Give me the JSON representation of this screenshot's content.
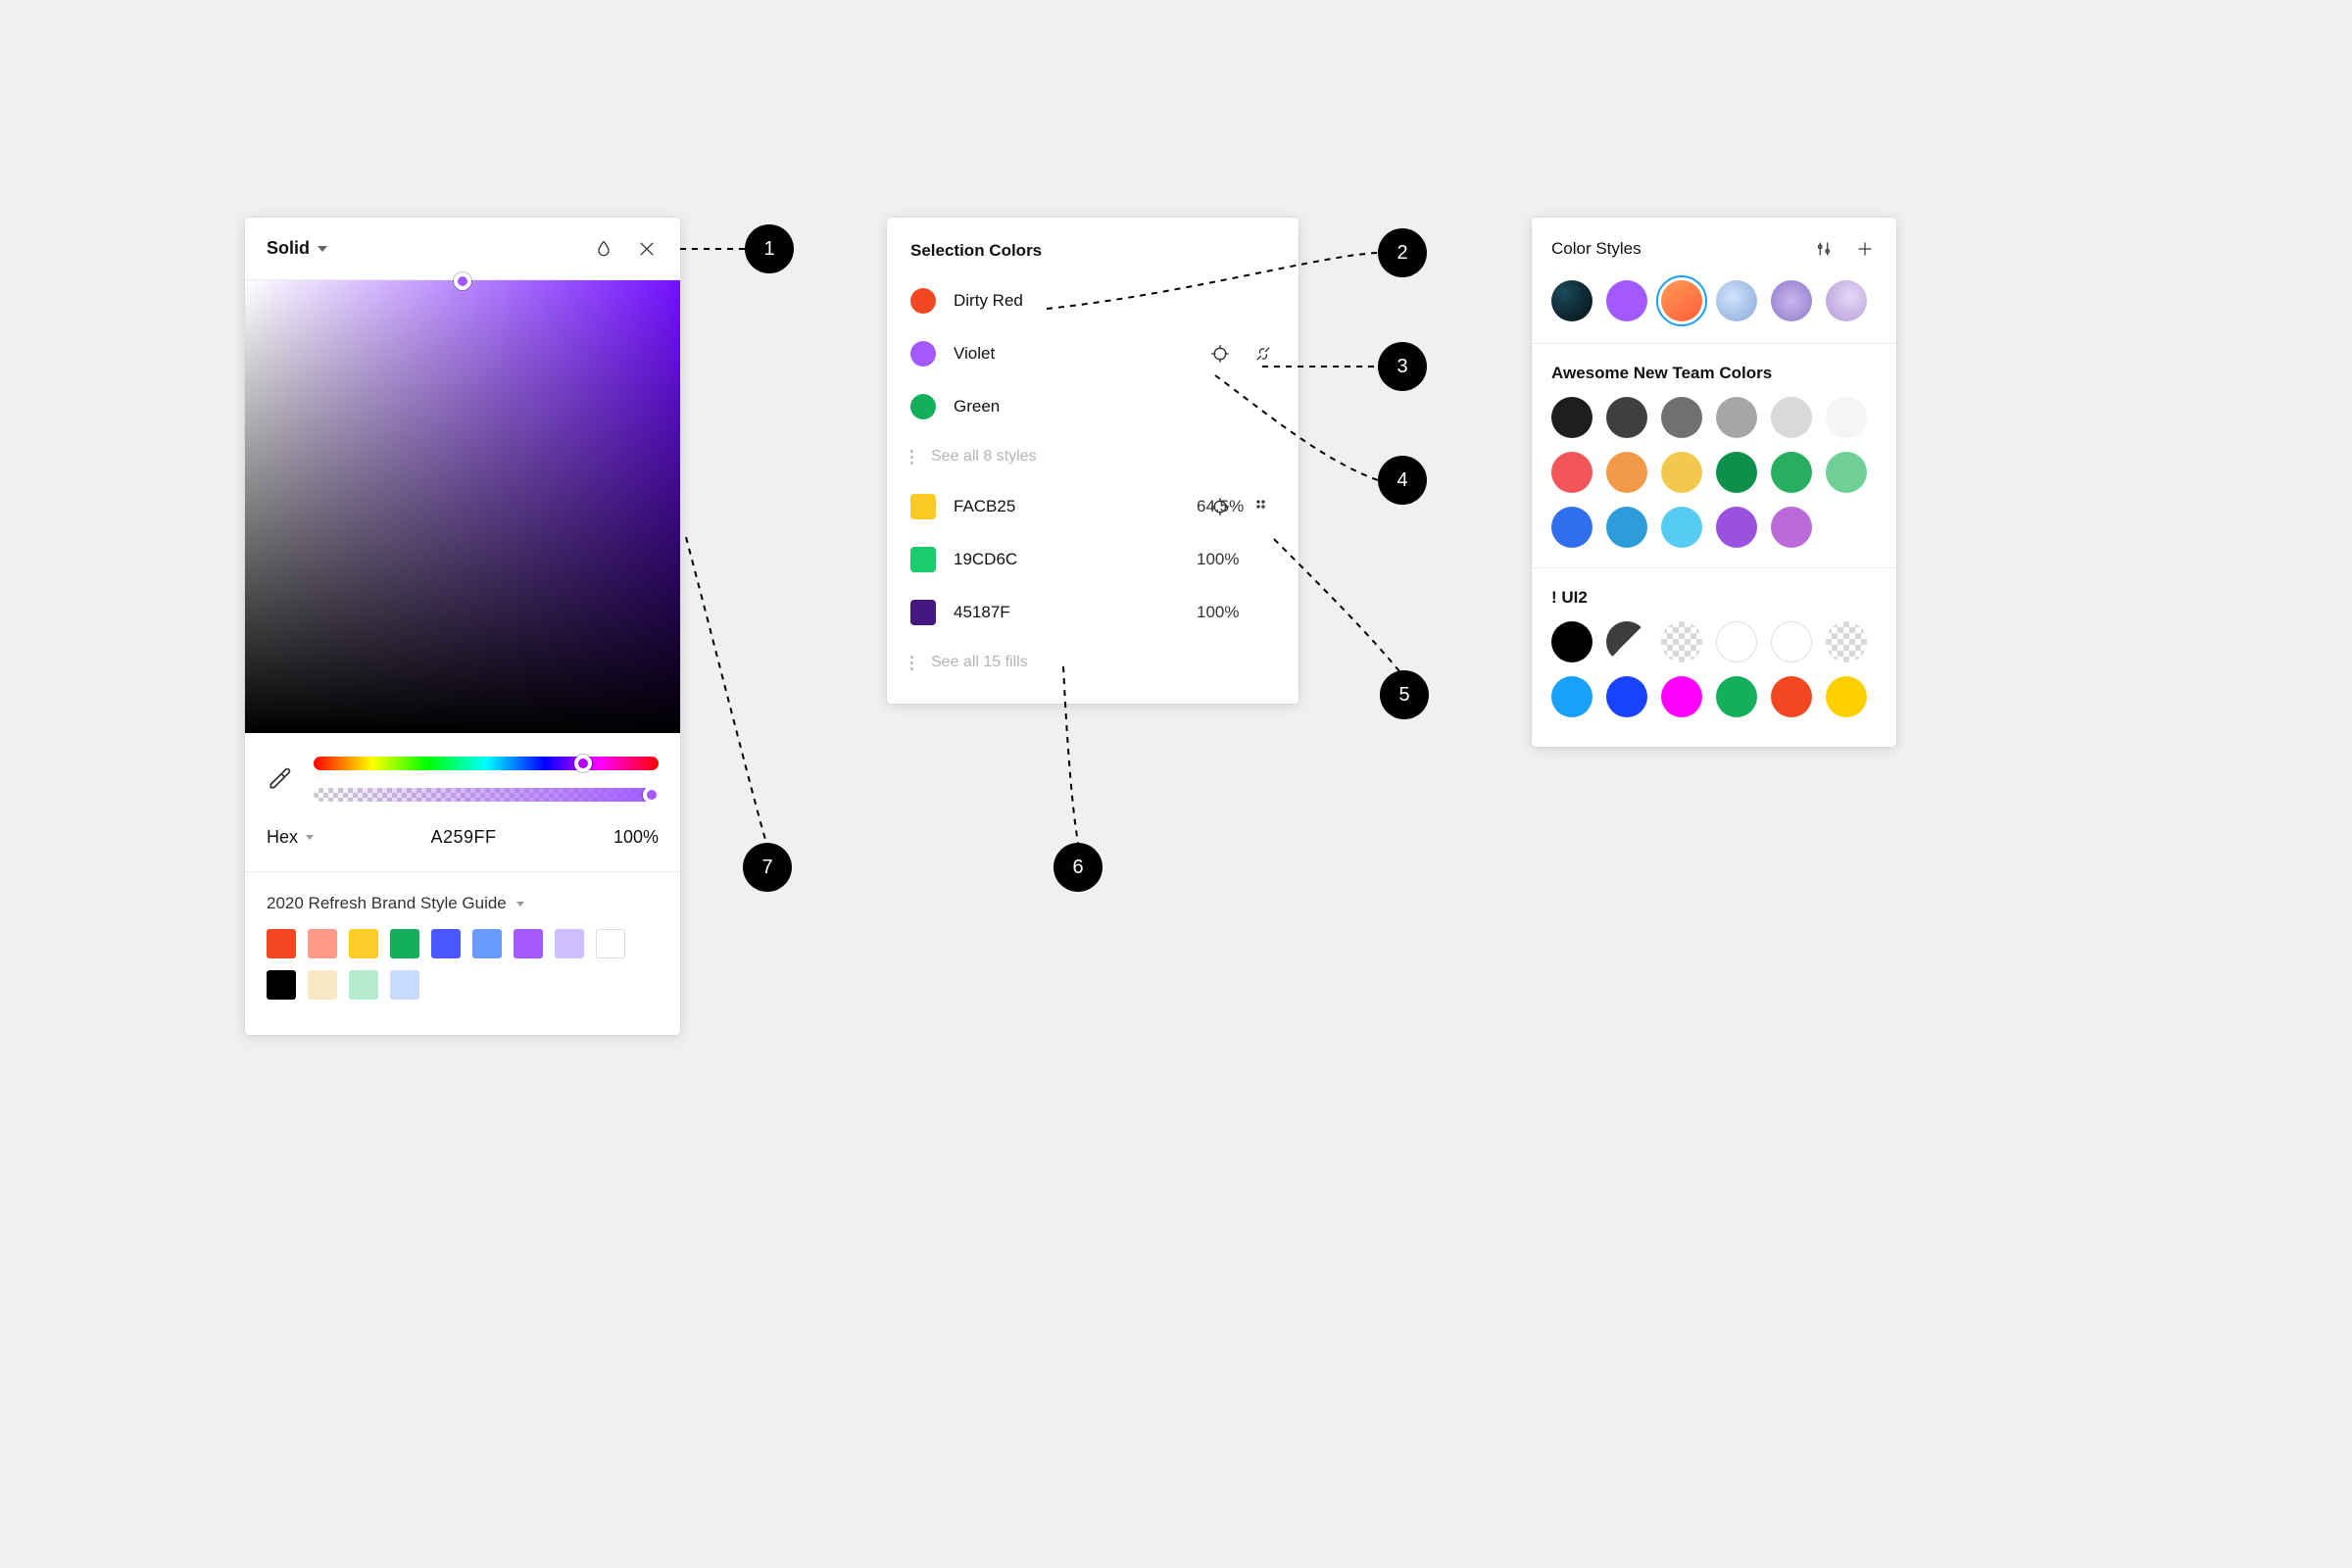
{
  "picker": {
    "mode_label": "Solid",
    "close_icon": "close-icon",
    "blend_icon": "droplet-icon",
    "hex_mode_label": "Hex",
    "hex_value": "A259FF",
    "opacity_value": "100%",
    "library_title": "2020 Refresh Brand Style Guide",
    "swatches": [
      "#F24822",
      "#FF9A8A",
      "#FFCD29",
      "#14AE5C",
      "#4A58FF",
      "#699BFF",
      "#A259FF",
      "#D0BFFF",
      "#FFFFFF",
      "#000000",
      "#F7E8C3",
      "#B6EBD0",
      "#C9DBFF"
    ]
  },
  "selection": {
    "title": "Selection Colors",
    "styles": [
      {
        "label": "Dirty Red",
        "color": "#F24822"
      },
      {
        "label": "Violet",
        "color": "#A259FF"
      },
      {
        "label": "Green",
        "color": "#14AE5C"
      }
    ],
    "see_styles": "See all 8 styles",
    "fills": [
      {
        "hex": "FACB25",
        "opacity": "64.5%",
        "color": "#FACB25"
      },
      {
        "hex": "19CD6C",
        "opacity": "100%",
        "color": "#19CD6C"
      },
      {
        "hex": "45187F",
        "opacity": "100%",
        "color": "#45187F"
      }
    ],
    "see_fills": "See all 15 fills"
  },
  "styles_panel": {
    "title": "Color Styles",
    "section_a_title": "Awesome New Team Colors",
    "section_a": [
      "#1E1E1E",
      "#3F3F3F",
      "#707070",
      "#A6A6A6",
      "#D9D9D9",
      "#F5F5F5",
      "#F2555A",
      "#F2994A",
      "#F2C94C",
      "#0C8F4B",
      "#27AE60",
      "#6FCF97",
      "#2F6FED",
      "#2D9CDB",
      "#56CCF2",
      "#9B51E0",
      "#BB6BD9"
    ],
    "section_b_title": "! UI2",
    "section_b_solid": [
      "#000000",
      "half",
      "ck",
      "ol-white",
      "ol-white",
      "ck",
      "#18A0FB",
      "#1843FB",
      "#FF00FF",
      "#14AE5C",
      "#F24822",
      "#FFCF00"
    ]
  },
  "annotations": [
    "1",
    "2",
    "3",
    "4",
    "5",
    "6",
    "7"
  ]
}
